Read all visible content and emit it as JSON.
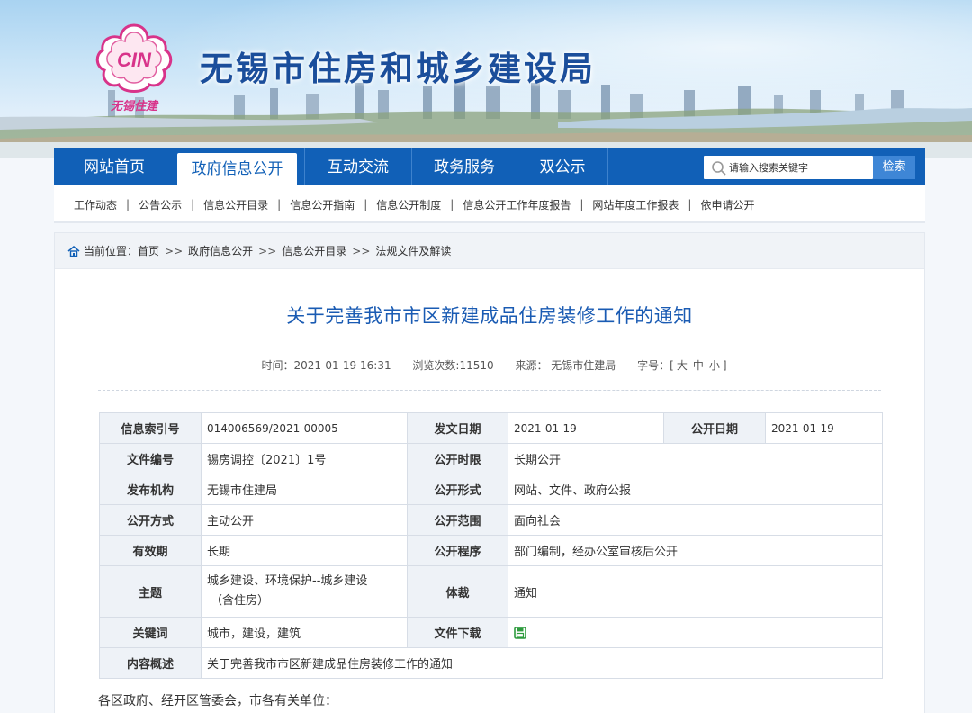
{
  "header": {
    "site_title": "无锡市住房和城乡建设局",
    "logo_text": "CIN",
    "logo_caption": "无锡住建"
  },
  "nav": {
    "tabs": [
      {
        "label": "网站首页",
        "active": false
      },
      {
        "label": "政府信息公开",
        "active": true
      },
      {
        "label": "互动交流",
        "active": false
      },
      {
        "label": "政务服务",
        "active": false
      },
      {
        "label": "双公示",
        "active": false
      }
    ],
    "search_placeholder": "请输入搜索关键字",
    "search_button": "检索"
  },
  "subnav": {
    "items": [
      "工作动态",
      "公告公示",
      "信息公开目录",
      "信息公开指南",
      "信息公开制度",
      "信息公开工作年度报告",
      "网站年度工作报表",
      "依申请公开"
    ]
  },
  "breadcrumb": {
    "prefix": "当前位置：",
    "items": [
      "首页",
      "政府信息公开",
      "信息公开目录",
      "法规文件及解读"
    ]
  },
  "article": {
    "title": "关于完善我市市区新建成品住房装修工作的通知",
    "time": "时间：2021-01-19 16:31",
    "views": "浏览次数:11510",
    "source": "来源： 无锡市住建局",
    "font_size_label": "字号：[",
    "font_large": "大",
    "font_medium": "中",
    "font_small": "小",
    "font_size_end": "]",
    "first_line": "各区政府、经开区管委会，市各有关单位："
  },
  "info_table": {
    "index_label": "信息索引号",
    "index_value": "014006569/2021-00005",
    "issue_date_label": "发文日期",
    "issue_date_value": "2021-01-19",
    "publish_date_label": "公开日期",
    "publish_date_value": "2021-01-19",
    "doc_no_label": "文件编号",
    "doc_no_value": "锡房调控〔2021〕1号",
    "limit_label": "公开时限",
    "limit_value": "长期公开",
    "org_label": "发布机构",
    "org_value": "无锡市住建局",
    "form_label": "公开形式",
    "form_value": "网站、文件、政府公报",
    "method_label": "公开方式",
    "method_value": "主动公开",
    "scope_label": "公开范围",
    "scope_value": "面向社会",
    "validity_label": "有效期",
    "validity_value": "长期",
    "procedure_label": "公开程序",
    "procedure_value": "部门编制，经办公室审核后公开",
    "topic_label": "主题",
    "topic_value_1": "城乡建设、环境保护--城乡建设",
    "topic_value_2": "（含住房）",
    "genre_label": "体裁",
    "genre_value": "通知",
    "keywords_label": "关键词",
    "keywords_value": "城市，建设，建筑",
    "download_label": "文件下载",
    "summary_label": "内容概述",
    "summary_value": "关于完善我市市区新建成品住房装修工作的通知"
  },
  "colors": {
    "nav_blue": "#1160b7",
    "title_blue": "#1a5bb3",
    "header_title": "#1b4e9b",
    "download_icon": "#2e9b3e",
    "logo_pink": "#d8338a"
  }
}
